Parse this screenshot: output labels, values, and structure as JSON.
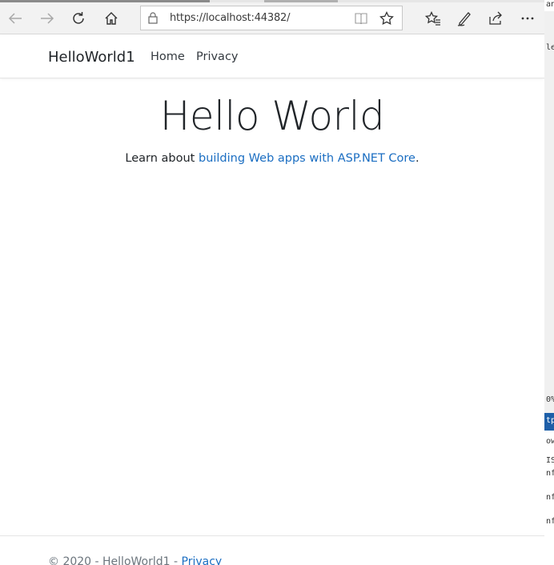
{
  "browser": {
    "url": "https://localhost:44382/",
    "icons": [
      "back-arrow-icon",
      "forward-arrow-icon",
      "refresh-icon",
      "home-icon",
      "lock-icon",
      "reading-view-icon",
      "favorite-star-icon",
      "favorites-hub-icon",
      "pen-icon",
      "share-icon",
      "more-icon"
    ]
  },
  "navbar": {
    "brand": "HelloWorld1",
    "links": [
      "Home",
      "Privacy"
    ]
  },
  "main": {
    "title": "Hello World",
    "text_prefix": "Learn about ",
    "link_text": "building Web apps with ASP.NET Core",
    "text_suffix": "."
  },
  "footer": {
    "copyright": "© 2020 - HelloWorld1 - ",
    "privacy_link": "Privacy"
  },
  "side_window": {
    "fragments": [
      "an",
      "lex",
      "0%",
      "tp",
      "ow",
      "IS",
      "nf",
      "nf",
      "nf"
    ]
  },
  "colors": {
    "link": "#1b6ec2",
    "text": "#212529",
    "toolbar": "#f2f2f2"
  }
}
